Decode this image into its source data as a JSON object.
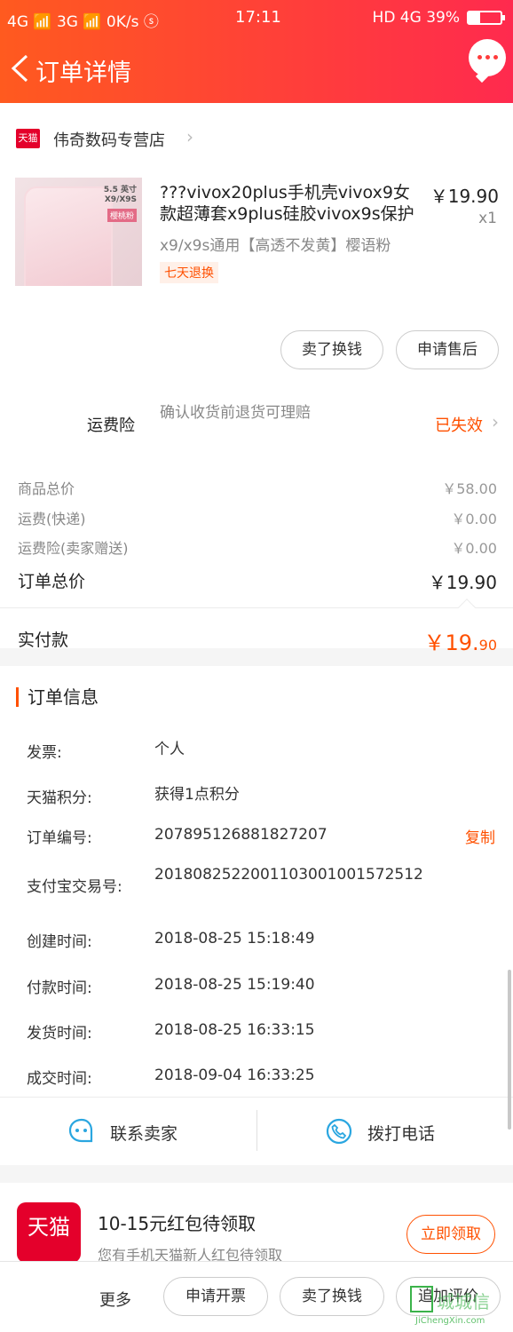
{
  "status_bar": {
    "left": "4G 📶 3G 📶 0K/s ⓢ",
    "time": "17:11",
    "right": "HD 4G 39%",
    "battery_percent": 39
  },
  "nav": {
    "title": "订单详情"
  },
  "store": {
    "badge": "天猫",
    "name": "伟奇数码专营店"
  },
  "product": {
    "title": "???vivox20plus手机壳vivox9女款超薄套x9plus硅胶vivox9s保护",
    "price": "￥19.90",
    "qty": "x1",
    "sku": "x9/x9s通用【高透不发黄】樱语粉",
    "tag": "七天退换",
    "image_labels": [
      "5.5 英寸",
      "X9/X9S",
      "樱桃粉"
    ]
  },
  "actions": {
    "sell_swap": "卖了换钱",
    "after_sale": "申请售后"
  },
  "insurance": {
    "label": "运费险",
    "desc": "确认收货前退货可理赔",
    "status": "已失效"
  },
  "costs": [
    {
      "label": "商品总价",
      "value": "￥58.00"
    },
    {
      "label": "运费(快递)",
      "value": "￥0.00"
    },
    {
      "label": "运费险(卖家赠送)",
      "value": "￥0.00"
    }
  ],
  "order_total": {
    "label": "订单总价",
    "value": "￥19.90"
  },
  "paid": {
    "label": "实付款",
    "value_main": "￥19.",
    "value_cents": "90"
  },
  "order_info": {
    "title": "订单信息",
    "copy": "复制",
    "rows": [
      {
        "k": "发票:",
        "v": "个人"
      },
      {
        "k": "天猫积分:",
        "v": "获得1点积分"
      },
      {
        "k": "订单编号:",
        "v": "207895126881827207"
      },
      {
        "k": "支付宝交易号:",
        "v": "2018082522001103001001572512"
      },
      {
        "k": "创建时间:",
        "v": "2018-08-25 15:18:49"
      },
      {
        "k": "付款时间:",
        "v": "2018-08-25 15:19:40"
      },
      {
        "k": "发货时间:",
        "v": "2018-08-25 16:33:15"
      },
      {
        "k": "成交时间:",
        "v": "2018-09-04 16:33:25"
      }
    ]
  },
  "contact": {
    "seller": "联系卖家",
    "call": "拨打电话"
  },
  "promo": {
    "icon": "天猫",
    "title": "10-15元红包待领取",
    "sub": "您有手机天猫新人红包待领取",
    "button": "立即领取"
  },
  "bottom": {
    "more": "更多",
    "invoice": "申请开票",
    "sell_swap": "卖了换钱",
    "review": "追加评价"
  },
  "watermark": {
    "text": "城城信",
    "url": "JiChengXin.com"
  },
  "colors": {
    "accent": "#ff5000",
    "nav_start": "#ff5a1f",
    "nav_end": "#ff2a4e",
    "tmall_red": "#e4002b",
    "contact_blue": "#2aa6e0"
  }
}
